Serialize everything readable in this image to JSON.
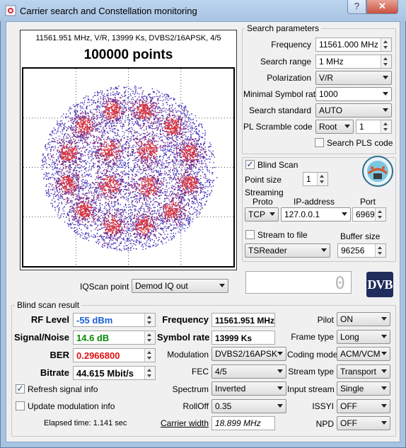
{
  "window": {
    "title": "Carrier search and Constellation monitoring",
    "help_symbol": "?",
    "close_symbol": "✕"
  },
  "constellation": {
    "info_line": "11561.951 MHz, V/R, 13999 Ks, DVBS2/16APSK, 4/5",
    "points_label": "100000 points"
  },
  "search_params": {
    "group_title": "Search parameters",
    "frequency": {
      "label": "Frequency",
      "value": "11561.000 MHz"
    },
    "search_range": {
      "label": "Search range",
      "value": "1 MHz"
    },
    "polarization": {
      "label": "Polarization",
      "value": "V/R"
    },
    "min_symbol_rate": {
      "label": "Minimal Symbol rate",
      "value": "1000"
    },
    "search_standard": {
      "label": "Search standard",
      "value": "AUTO"
    },
    "pl_scramble": {
      "label": "PL Scramble code",
      "mode": "Root",
      "value": "1"
    },
    "search_pls": {
      "label": "Search PLS code",
      "checked": false
    }
  },
  "blind_scan_box": {
    "blind_scan": {
      "label": "Blind Scan",
      "checked": true,
      "mark": "✓"
    },
    "point_size": {
      "label": "Point size",
      "value": "1"
    }
  },
  "streaming": {
    "group_title": "Streaming",
    "proto_label": "Proto",
    "ip_label": "IP-address",
    "port_label": "Port",
    "proto": "TCP",
    "ip": "127.0.0.1",
    "port": "6969",
    "stream_to_file": {
      "label": "Stream to file",
      "checked": false
    },
    "buffer_label": "Buffer size",
    "reader": "TSReader",
    "buffer_size": "96256"
  },
  "iqscan": {
    "label": "IQScan point",
    "value": "Demod IQ out"
  },
  "readout_display": "0",
  "logo_text": "DVB",
  "result": {
    "group_title": "Blind scan result",
    "rf_level": {
      "label": "RF Level",
      "value": "-55 dBm",
      "color": "#1a5fd6"
    },
    "snr": {
      "label": "Signal/Noise",
      "value": "14.6 dB",
      "color": "#0a8a0a"
    },
    "ber": {
      "label": "BER",
      "value": "0.2966800",
      "color": "#e01010"
    },
    "bitrate": {
      "label": "Bitrate",
      "value": "44.615 Mbit/s"
    },
    "frequency": {
      "label": "Frequency",
      "value": "11561.951 MHz"
    },
    "symbol_rate": {
      "label": "Symbol rate",
      "value": "13999 Ks"
    },
    "modulation": {
      "label": "Modulation",
      "value": "DVBS2/16APSK"
    },
    "fec": {
      "label": "FEC",
      "value": "4/5"
    },
    "spectrum": {
      "label": "Spectrum",
      "value": "Inverted"
    },
    "rolloff": {
      "label": "RollOff",
      "value": "0.35"
    },
    "carrier_width": {
      "label": "Carrier width",
      "value": "18.899 MHz"
    },
    "pilot": {
      "label": "Pilot",
      "value": "ON"
    },
    "frame_type": {
      "label": "Frame type",
      "value": "Long"
    },
    "coding_mode": {
      "label": "Coding mode",
      "value": "ACM/VCM"
    },
    "stream_type": {
      "label": "Stream type",
      "value": "Transport"
    },
    "input_stream": {
      "label": "Input stream",
      "value": "Single"
    },
    "issyi": {
      "label": "ISSYI",
      "value": "OFF"
    },
    "npd": {
      "label": "NPD",
      "value": "OFF"
    },
    "refresh_signal": {
      "label": "Refresh signal info",
      "checked": true,
      "mark": "✓"
    },
    "update_modulation": {
      "label": "Update modulation info",
      "checked": false
    },
    "elapsed": "Elapsed time: 1.141 sec"
  }
}
